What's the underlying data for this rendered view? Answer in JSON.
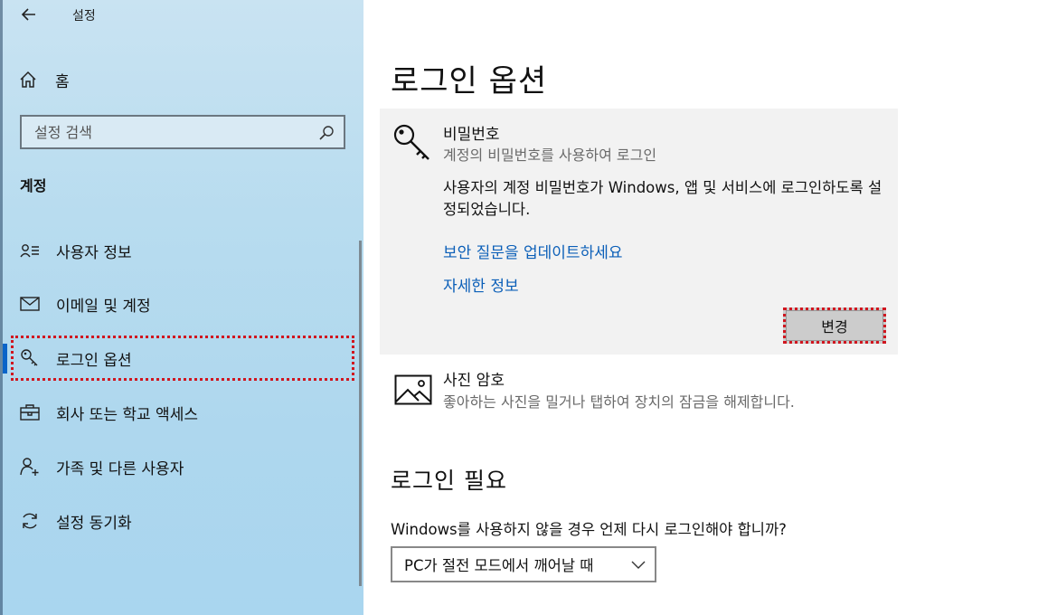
{
  "window": {
    "title": "설정",
    "back_icon": "arrow-left-icon"
  },
  "sidebar": {
    "home_label": "홈",
    "search_placeholder": "설정 검색",
    "section_heading": "계정",
    "items": [
      {
        "label": "사용자 정보",
        "icon": "person-card-icon"
      },
      {
        "label": "이메일 및 계정",
        "icon": "mail-icon"
      },
      {
        "label": "로그인 옵션",
        "icon": "key-icon",
        "selected": true
      },
      {
        "label": "회사 또는 학교 액세스",
        "icon": "briefcase-icon"
      },
      {
        "label": "가족 및 다른 사용자",
        "icon": "person-add-icon"
      },
      {
        "label": "설정 동기화",
        "icon": "sync-icon"
      }
    ]
  },
  "main": {
    "title": "로그인 옵션",
    "password": {
      "title": "비밀번호",
      "subtitle": "계정의 비밀번호를 사용하여 로그인",
      "description": "사용자의 계정 비밀번호가 Windows, 앱 및 서비스에 로그인하도록 설정되었습니다.",
      "link_security": "보안 질문을 업데이트하세요",
      "link_more": "자세한 정보",
      "change_button": "변경"
    },
    "picture_password": {
      "title": "사진 암호",
      "subtitle": "좋아하는 사진을 밀거나 탭하여 장치의 잠금을 해제합니다."
    },
    "require_signin": {
      "heading": "로그인 필요",
      "question": "Windows를 사용하지 않을 경우 언제 다시 로그인해야 합니까?",
      "dropdown_value": "PC가 절전 모드에서 깨어날 때"
    }
  },
  "colors": {
    "accent": "#0a64c8",
    "link": "#0b5fb8",
    "highlight": "#d0161f"
  }
}
